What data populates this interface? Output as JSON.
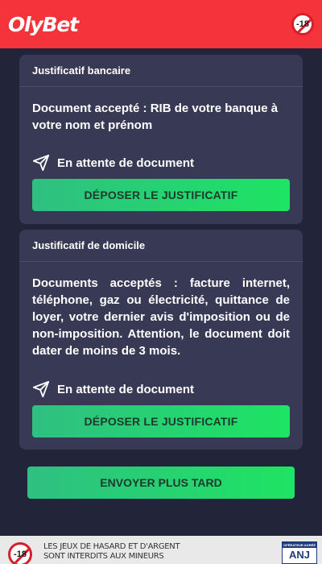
{
  "header": {
    "logo_text": "OlyBet",
    "age_badge": "-18",
    "background": "#f5333a"
  },
  "cards": [
    {
      "title": "Justificatif bancaire",
      "description": "Document accepté : RIB de votre banque à votre nom et prénom",
      "status": "En attente de document",
      "status_icon": "send-icon",
      "button_label": "DÉPOSER LE JUSTIFICATIF"
    },
    {
      "title": "Justificatif de domicile",
      "description": "Documents acceptés : facture internet, téléphone, gaz ou électricité, quittance de loyer, votre dernier avis d'imposition ou de non-imposition. Attention, le document doit dater de moins de 3 mois.",
      "status": "En attente de document",
      "status_icon": "send-icon",
      "button_label": "DÉPOSER LE JUSTIFICATIF"
    }
  ],
  "send_later_label": "ENVOYER PLUS TARD",
  "footer": {
    "age_badge": "-18",
    "warning_line1": "LES JEUX DE HASARD ET D'ARGENT",
    "warning_line2": "SONT INTERDITS AUX MINEURS",
    "anj_top": "OPÉRATEUR AGRÉÉ",
    "anj_name": "ANJ"
  },
  "colors": {
    "page_background": "#22243a",
    "card_background": "#383a55",
    "button_gradient_start": "#2fbf82",
    "button_gradient_end": "#1ee463"
  }
}
